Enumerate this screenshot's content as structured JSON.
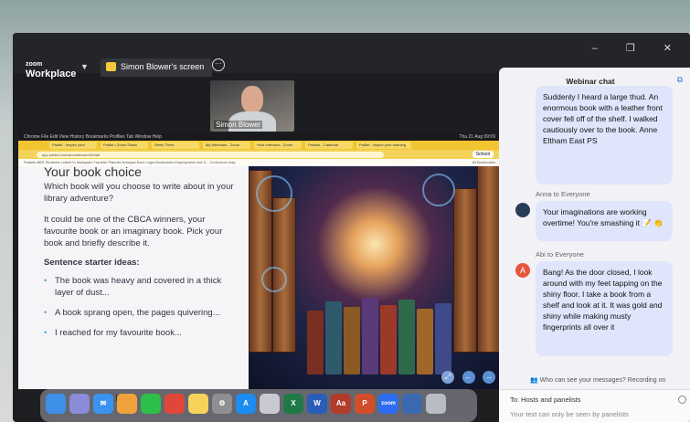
{
  "zoom": {
    "logo_small": "zoom",
    "logo_big": "Workplace",
    "share_tab": "Simon Blower's screen",
    "window_controls": "– ❐ ✕"
  },
  "video": {
    "name": "Simon Blower"
  },
  "browser": {
    "menubar": "Chrome  File  Edit  View  History  Bookmarks  Profiles  Tab  Window  Help",
    "menubar_right": "Thu 21 Aug 09:09",
    "tabs": [
      "Padlet - Inspire your learning",
      "Padlet • Zoom Share",
      "Week Three",
      "My Webinars - Zoom",
      "Host Interview - Zoom",
      "Padlets - Calendar",
      "Padlet - inspire your learning"
    ],
    "url": "app.padlet.com/simonblower/4b4a6",
    "bookmarks": "Padlets   BBS Students   Linked In   Instagram   Transfer Planner   Notepad   Earn Login   Bookmarks   Employment and S...   Curriculum map",
    "school_button": "School",
    "all_bookmarks": "All Bookmarks"
  },
  "slide": {
    "title": "Your book choice",
    "question": "Which book will you choose to write about in your library adventure?",
    "paragraph": "It could be one of the CBCA winners, your favourite book or an imaginary book. Pick your book and briefly describe it.",
    "starter_heading": "Sentence starter ideas:",
    "bullets": [
      "The book was heavy and covered in a thick layer of dust...",
      "A book sprang open, the pages quivering...",
      "I reached for my favourite book..."
    ]
  },
  "dock": {
    "apps": [
      {
        "name": "finder-icon",
        "color": "#3d8fe8",
        "label": ""
      },
      {
        "name": "launchpad-icon",
        "color": "#8b8bd8",
        "label": ""
      },
      {
        "name": "mail-icon",
        "color": "#3a93f0",
        "label": "✉"
      },
      {
        "name": "photos-icon",
        "color": "#f0a33c",
        "label": ""
      },
      {
        "name": "facetime-icon",
        "color": "#2cbf4a",
        "label": ""
      },
      {
        "name": "chrome-icon",
        "color": "#e0473a",
        "label": ""
      },
      {
        "name": "notes-icon",
        "color": "#f7d35a",
        "label": ""
      },
      {
        "name": "settings-icon",
        "color": "#8e8e93",
        "label": "⚙"
      },
      {
        "name": "app-store-icon",
        "color": "#1d8cf0",
        "label": "A"
      },
      {
        "name": "books-icon",
        "color": "#c9c9d2",
        "label": ""
      },
      {
        "name": "excel-icon",
        "color": "#1e7a45",
        "label": "X"
      },
      {
        "name": "word-icon",
        "color": "#2a5db8",
        "label": "W"
      },
      {
        "name": "dictionary-icon",
        "color": "#b43a2a",
        "label": "Aa"
      },
      {
        "name": "powerpoint-icon",
        "color": "#d14e2a",
        "label": "P"
      },
      {
        "name": "zoom-icon",
        "color": "#2d6cf0",
        "label": "zoom"
      },
      {
        "name": "preview-icon",
        "color": "#3c6ab0",
        "label": ""
      },
      {
        "name": "trash-icon",
        "color": "#b8bcc4",
        "label": ""
      }
    ]
  },
  "chat": {
    "title": "Webinar chat",
    "message1": "Suddenly I heard a large thud. An enormous book with a leather front cover fell off of the shelf. I walked cautiously over to the book. Anne Eltham East PS",
    "sender2": "Anna to Everyone",
    "message2": "Your imaginations are working overtime! You're smashing it 📝 👏",
    "sender3": "Abi to Everyone",
    "avatar3": "A",
    "message3": "Bang! As the door closed, I look around with my feet tapping on the shiny floor. I take a book from a shelf and look at it. It was gold and shiny while making musty fingerprints all over it",
    "who_can_see": "Who can see your messages? Recording on",
    "to_label": "To:  Hosts and panelists",
    "input_placeholder": "Your text can only be seen by panelists"
  },
  "colors": {
    "accent": "#3c6fd6",
    "chat_bubble": "#dfe5fb",
    "browser_bar": "#f1c531"
  }
}
